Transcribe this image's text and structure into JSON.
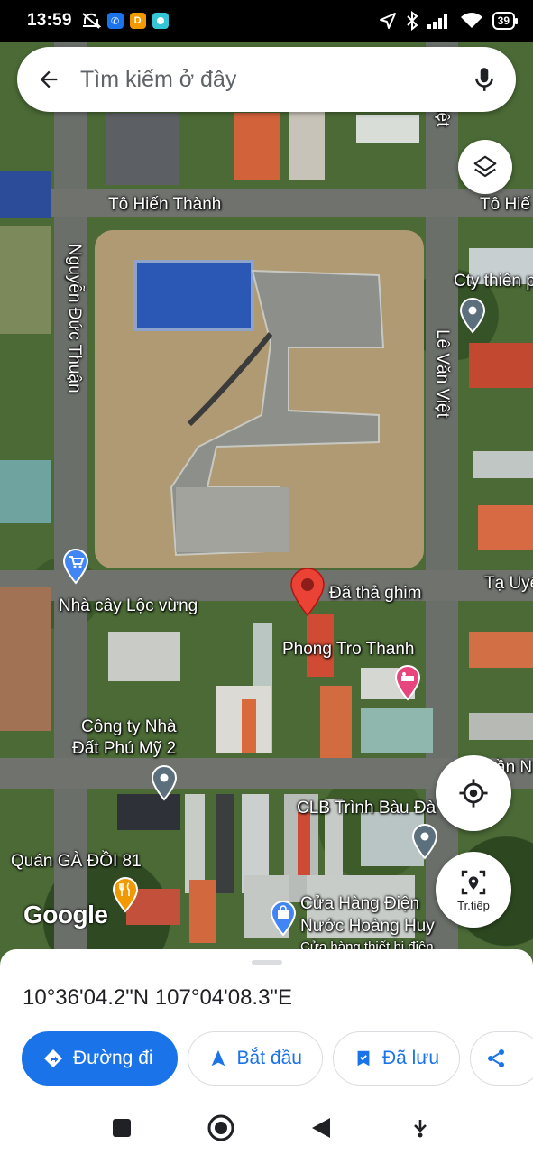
{
  "status_bar": {
    "time": "13:59",
    "battery": "39",
    "icons": [
      "mute-icon",
      "phone-app-icon",
      "d-app-icon",
      "camera-app-icon",
      "location-arrow-icon",
      "bluetooth-icon",
      "signal-icon",
      "wifi-icon",
      "battery-icon"
    ],
    "app_d_letter": "D"
  },
  "search": {
    "placeholder": "Tìm kiếm ở đây",
    "back_icon": "arrow-back-icon",
    "mic_icon": "microphone-icon"
  },
  "map": {
    "road_labels": {
      "to_hien_thanh": "Tô Hiến Thành",
      "to_hien_thanh_cut": "Tô Hiế",
      "nguyen_duc_thuan": "Nguyễn Đức Thuận",
      "le_van_viet": "Lê Văn Việt",
      "le_van_viet_top": "Việt",
      "ta_uye": "Tạ Uyê",
      "van_n": "ần N"
    },
    "dropped_pin_label": "Đã thả ghim",
    "pois": {
      "cty_thien": "Cty thiên p",
      "nha_cay": "Nhà cây Lộc vừng",
      "phong_tro": "Phong Tro Thanh",
      "cong_ty_line1": "Công ty Nhà",
      "cong_ty_line2": "Đất Phú Mỹ 2",
      "clb": "CLB Trình Bàu Đà",
      "quan_ga": "Quán GÀ ĐỒI 81",
      "cua_hang_line1": "Cửa Hàng Điện",
      "cua_hang_line2": "Nước Hoàng Huy",
      "cua_hang_line3": "Cửa hàng thiết bị điện"
    },
    "google_logo": "Google",
    "layers_icon": "layers-icon",
    "my_location_icon": "my-location-icon",
    "travel_label": "Tr.tiếp",
    "colors": {
      "pin_red": "#ea4335",
      "poi_gray": "#5b6f7c",
      "poi_blue": "#4285f4",
      "poi_pink": "#e7457d",
      "poi_orange": "#f29900"
    }
  },
  "sheet": {
    "coordinates": "10°36'04.2\"N 107°04'08.3\"E",
    "chips": {
      "directions": "Đường đi",
      "start": "Bắt đầu",
      "saved": "Đã lưu"
    }
  },
  "navbar": {
    "icons": [
      "recents-square-icon",
      "home-circle-icon",
      "back-triangle-icon",
      "download-icon"
    ]
  }
}
